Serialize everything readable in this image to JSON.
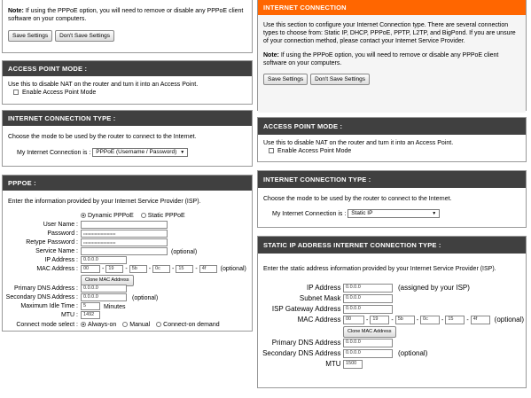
{
  "left": {
    "top_panel": {
      "note_label": "Note:",
      "note_text": "If using the PPPoE option, you will need to remove or disable any PPPoE client software on your computers.",
      "save_label": "Save Settings",
      "dont_save_label": "Don't Save Settings"
    },
    "ap_mode": {
      "header": "ACCESS POINT MODE :",
      "desc": "Use this to disable NAT on the router and turn it into an Access Point.",
      "checkbox_label": "Enable Access Point Mode"
    },
    "conn_type": {
      "header": "INTERNET CONNECTION TYPE :",
      "desc": "Choose the mode to be used by the router to connect to the Internet.",
      "select_label": "My Internet Connection is :",
      "select_value": "PPPoE (Username / Password)"
    },
    "pppoe": {
      "header": "PPPOE :",
      "desc": "Enter the information provided by your Internet Service Provider (ISP).",
      "dynamic_label": "Dynamic PPPoE",
      "static_label": "Static PPPoE",
      "username_label": "User Name :",
      "password_label": "Password :",
      "password_value": "••••••••••••••••••••••••••",
      "retype_label": "Retype Password :",
      "retype_value": "••••••••••••••••••••••••••",
      "service_label": "Service Name :",
      "optional": "(optional)",
      "ip_label": "IP Address :",
      "ip_value": "0.0.0.0",
      "mac_label": "MAC Address :",
      "mac": [
        "00",
        "19",
        "5b",
        "0c",
        "15",
        "4f"
      ],
      "clone_label": "Clone MAC Address",
      "pdns_label": "Primary DNS Address :",
      "pdns_value": "0.0.0.0",
      "sdns_label": "Secondary DNS Address :",
      "sdns_value": "0.0.0.0",
      "idle_label": "Maximum Idle Time :",
      "idle_value": "5",
      "idle_unit": "Minutes",
      "mtu_label": "MTU :",
      "mtu_value": "1492",
      "connect_label": "Connect mode select :",
      "always_on": "Always-on",
      "manual": "Manual",
      "on_demand": "Connect-on demand"
    }
  },
  "right": {
    "internet_conn": {
      "header": "INTERNET CONNECTION",
      "desc": "Use this section to configure your Internet Connection type. There are several connection types to choose from: Static IP, DHCP, PPPoE, PPTP, L2TP, and BigPond. If you are unsure of your connection method, please contact your Internet Service Provider.",
      "note_label": "Note:",
      "note_text": "If using the PPPoE option, you will need to remove or disable any PPPoE client software on your computers.",
      "save_label": "Save Settings",
      "dont_save_label": "Don't Save Settings"
    },
    "ap_mode": {
      "header": "ACCESS POINT MODE :",
      "desc": "Use this to disable NAT on the router and turn it into an Access Point.",
      "checkbox_label": "Enable Access Point Mode"
    },
    "conn_type": {
      "header": "INTERNET CONNECTION TYPE :",
      "desc": "Choose the mode to be used by the router to connect to the Internet.",
      "select_label": "My Internet Connection is :",
      "select_value": "Static IP"
    },
    "static_ip": {
      "header": "STATIC IP ADDRESS INTERNET CONNECTION TYPE :",
      "desc": "Enter the static address information provided by your Internet Service Provider (ISP).",
      "ip_label": "IP Address :",
      "ip_value": "0.0.0.0",
      "ip_note": "(assigned by your ISP)",
      "mask_label": "Subnet Mask :",
      "mask_value": "0.0.0.0",
      "gw_label": "ISP Gateway Address :",
      "gw_value": "0.0.0.0",
      "mac_label": "MAC Address :",
      "mac": [
        "00",
        "19",
        "5b",
        "0c",
        "15",
        "4f"
      ],
      "optional": "(optional)",
      "clone_label": "Clone MAC Address",
      "pdns_label": "Primary DNS Address :",
      "pdns_value": "0.0.0.0",
      "sdns_label": "Secondary DNS Address :",
      "sdns_value": "0.0.0.0",
      "mtu_label": "MTU :",
      "mtu_value": "1500"
    }
  },
  "colors": {
    "header_dark": "#404040",
    "header_orange": "#ff6600"
  }
}
